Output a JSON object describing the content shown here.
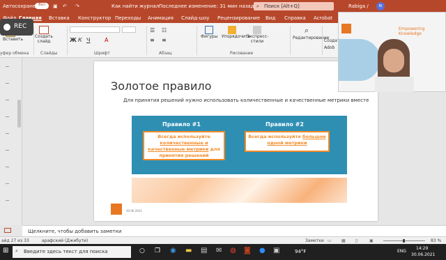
{
  "titlebar": {
    "autosave_label": "Автосохранение",
    "toggle_state": "Вкл",
    "doc_title": "Как найти журнал",
    "last_change": "Последнее изменение: 31 мин назад",
    "search_placeholder": "Поиск [Alt+Q]",
    "user_name": "Rabiga /",
    "user_initials": "RI"
  },
  "ribbon_tabs": [
    "Файл",
    "Главная",
    "Вставка",
    "Конструктор",
    "Переходы",
    "Анимация",
    "Слайд-шоу",
    "Рецензирование",
    "Вид",
    "Справка",
    "Acrobat"
  ],
  "ribbon": {
    "paste": "Вставить",
    "create_slide": "Создать слайд",
    "clipboard": "уфер обмена",
    "slides": "Слайды",
    "font": "Шрифт",
    "paragraph": "Абзац",
    "shapes": "Фигуры",
    "arrange": "Упорядочить",
    "express_styles": "Экспресс-стили",
    "drawing": "Рисование",
    "editing": "Редактирование",
    "create_partial": "Создат",
    "adobe_partial": "Adob"
  },
  "slide": {
    "title": "Золотое правило",
    "subtitle": "Для принятия решений нужно использовать количественные и качественные метрики вместе",
    "rule1_heading": "Правило #1",
    "rule1_pre": "Всегда используйте",
    "rule1_link": "количественные и качественные метрики",
    "rule1_post": "для принятия решений",
    "rule2_heading": "Правило #2",
    "rule2_pre": "Всегда используйте",
    "rule2_link": "большое одной метрики",
    "date": "30.06.2021"
  },
  "notes_placeholder": "Щелкните, чтобы добавить заметки",
  "status": {
    "slide_counter": "айд 27 из 33",
    "language": "арафский (Джибути)",
    "notes_label": "Заметки",
    "zoom": "83 %"
  },
  "taskbar": {
    "search_placeholder": "Введите здесь текст для поиска",
    "weather": "94°F",
    "lang": "ENG",
    "time": "14:29",
    "date": "30.06.2021"
  },
  "webcam": {
    "tagline": "Empowering Knowledge"
  },
  "rec_label": "REC",
  "colors": {
    "brand": "#b7472a",
    "accent_orange": "#f28c28",
    "rule_box_blue": "#2e8fb3"
  }
}
